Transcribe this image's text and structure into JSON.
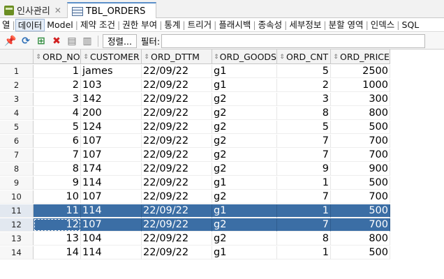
{
  "tabs": [
    {
      "label": "인사관리",
      "icon": "database-icon"
    },
    {
      "label": "TBL_ORDERS",
      "icon": "table-icon",
      "active": true
    }
  ],
  "subtabs": [
    "열",
    "데이터",
    "Model",
    "제약 조건",
    "권한 부여",
    "통계",
    "트리거",
    "플래시백",
    "종속성",
    "세부정보",
    "분할 영역",
    "인덱스",
    "SQL"
  ],
  "selected_subtab": "데이터",
  "toolbar": {
    "sort_label": "정렬...",
    "filter_label": "필터:",
    "icons": [
      "pin-icon",
      "refresh-icon",
      "insert-row-icon",
      "delete-row-icon",
      "commit-icon",
      "rollback-icon"
    ]
  },
  "grid": {
    "columns": [
      "ORD_NO",
      "CUSTOMER",
      "ORD_DTTM",
      "ORD_GOODS",
      "ORD_CNT",
      "ORD_PRICE"
    ],
    "rows": [
      {
        "n": "1",
        "cells": [
          "1",
          "james",
          "22/09/22",
          "g1",
          "5",
          "2500"
        ]
      },
      {
        "n": "2",
        "cells": [
          "2",
          "103",
          "22/09/22",
          "g1",
          "2",
          "1000"
        ]
      },
      {
        "n": "3",
        "cells": [
          "3",
          "142",
          "22/09/22",
          "g2",
          "3",
          "300"
        ]
      },
      {
        "n": "4",
        "cells": [
          "4",
          "200",
          "22/09/22",
          "g2",
          "8",
          "800"
        ]
      },
      {
        "n": "5",
        "cells": [
          "5",
          "124",
          "22/09/22",
          "g2",
          "5",
          "500"
        ]
      },
      {
        "n": "6",
        "cells": [
          "6",
          "107",
          "22/09/22",
          "g2",
          "7",
          "700"
        ]
      },
      {
        "n": "7",
        "cells": [
          "7",
          "107",
          "22/09/22",
          "g2",
          "7",
          "700"
        ]
      },
      {
        "n": "8",
        "cells": [
          "8",
          "174",
          "22/09/22",
          "g2",
          "9",
          "900"
        ]
      },
      {
        "n": "9",
        "cells": [
          "9",
          "114",
          "22/09/22",
          "g1",
          "1",
          "500"
        ]
      },
      {
        "n": "10",
        "cells": [
          "10",
          "107",
          "22/09/22",
          "g2",
          "7",
          "700"
        ]
      },
      {
        "n": "11",
        "cells": [
          "11",
          "114",
          "22/09/22",
          "g1",
          "1",
          "500"
        ],
        "selected": true
      },
      {
        "n": "12",
        "cells": [
          "12",
          "107",
          "22/09/22",
          "g2",
          "7",
          "700"
        ],
        "selected": true,
        "focused": true
      },
      {
        "n": "13",
        "cells": [
          "13",
          "104",
          "22/09/22",
          "g2",
          "8",
          "800"
        ]
      },
      {
        "n": "14",
        "cells": [
          "14",
          "114",
          "22/09/22",
          "g1",
          "1",
          "500"
        ]
      }
    ]
  },
  "colors": {
    "selection": "#3b6ea5",
    "tab_accent": "#5b8fc9"
  }
}
